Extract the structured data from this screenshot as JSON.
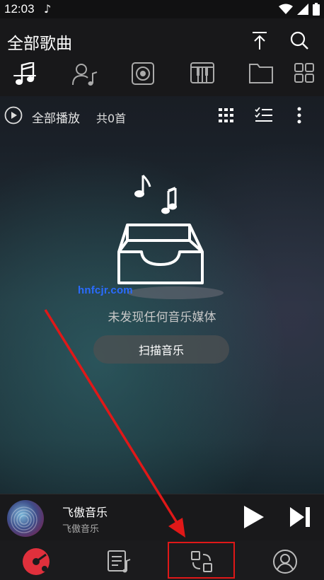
{
  "status_bar": {
    "time": "12:03",
    "notification_icon": "music-note-icon",
    "icons": [
      "wifi-icon",
      "signal-icon",
      "battery-icon"
    ]
  },
  "header": {
    "title": "全部歌曲",
    "actions": [
      "sort-top-icon",
      "search-icon"
    ]
  },
  "tabs": [
    {
      "icon": "music-note-icon",
      "selected": true
    },
    {
      "icon": "artist-icon",
      "selected": false
    },
    {
      "icon": "album-icon",
      "selected": false
    },
    {
      "icon": "piano-icon",
      "selected": false
    },
    {
      "icon": "folder-icon",
      "selected": false
    },
    {
      "icon": "grid-icon",
      "selected": false
    }
  ],
  "toolbar": {
    "play_all_label": "全部播放",
    "count_label": "共0首",
    "actions": [
      "grid-view-icon",
      "checklist-icon",
      "more-icon"
    ]
  },
  "empty_state": {
    "message": "未发现任何音乐媒体",
    "scan_button_label": "扫描音乐"
  },
  "watermark": "hnfcjr.com",
  "player": {
    "song_title": "飞傲音乐",
    "artist": "飞傲音乐"
  },
  "bottom_nav": [
    {
      "icon": "vinyl-record-icon",
      "active": true
    },
    {
      "icon": "playlist-icon",
      "active": false
    },
    {
      "icon": "switch-icon",
      "active": false,
      "highlighted": true
    },
    {
      "icon": "user-icon",
      "active": false
    }
  ],
  "colors": {
    "accent": "#e0303c",
    "highlight_box": "#e01818",
    "watermark": "#2a6cff"
  }
}
